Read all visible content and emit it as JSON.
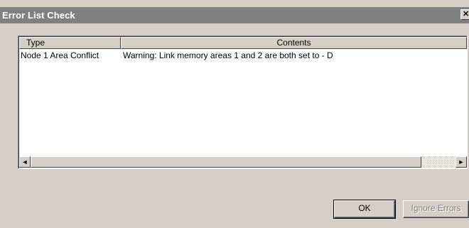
{
  "window": {
    "title": "Error List Check",
    "close_label": "✕"
  },
  "list": {
    "columns": [
      "Type",
      "Contents"
    ],
    "rows": [
      {
        "type": "Node 1 Area Conflict",
        "contents": "Warning: Link memory areas 1 and 2 are both set to - D"
      }
    ]
  },
  "scrollbar": {
    "left_arrow": "◄",
    "right_arrow": "►"
  },
  "buttons": {
    "ok": "OK",
    "ignore": "Ignore Errors"
  },
  "colors": {
    "titlebar": "#808080",
    "dialog_face": "#d4d0c8",
    "list_bg": "#ffffff"
  }
}
